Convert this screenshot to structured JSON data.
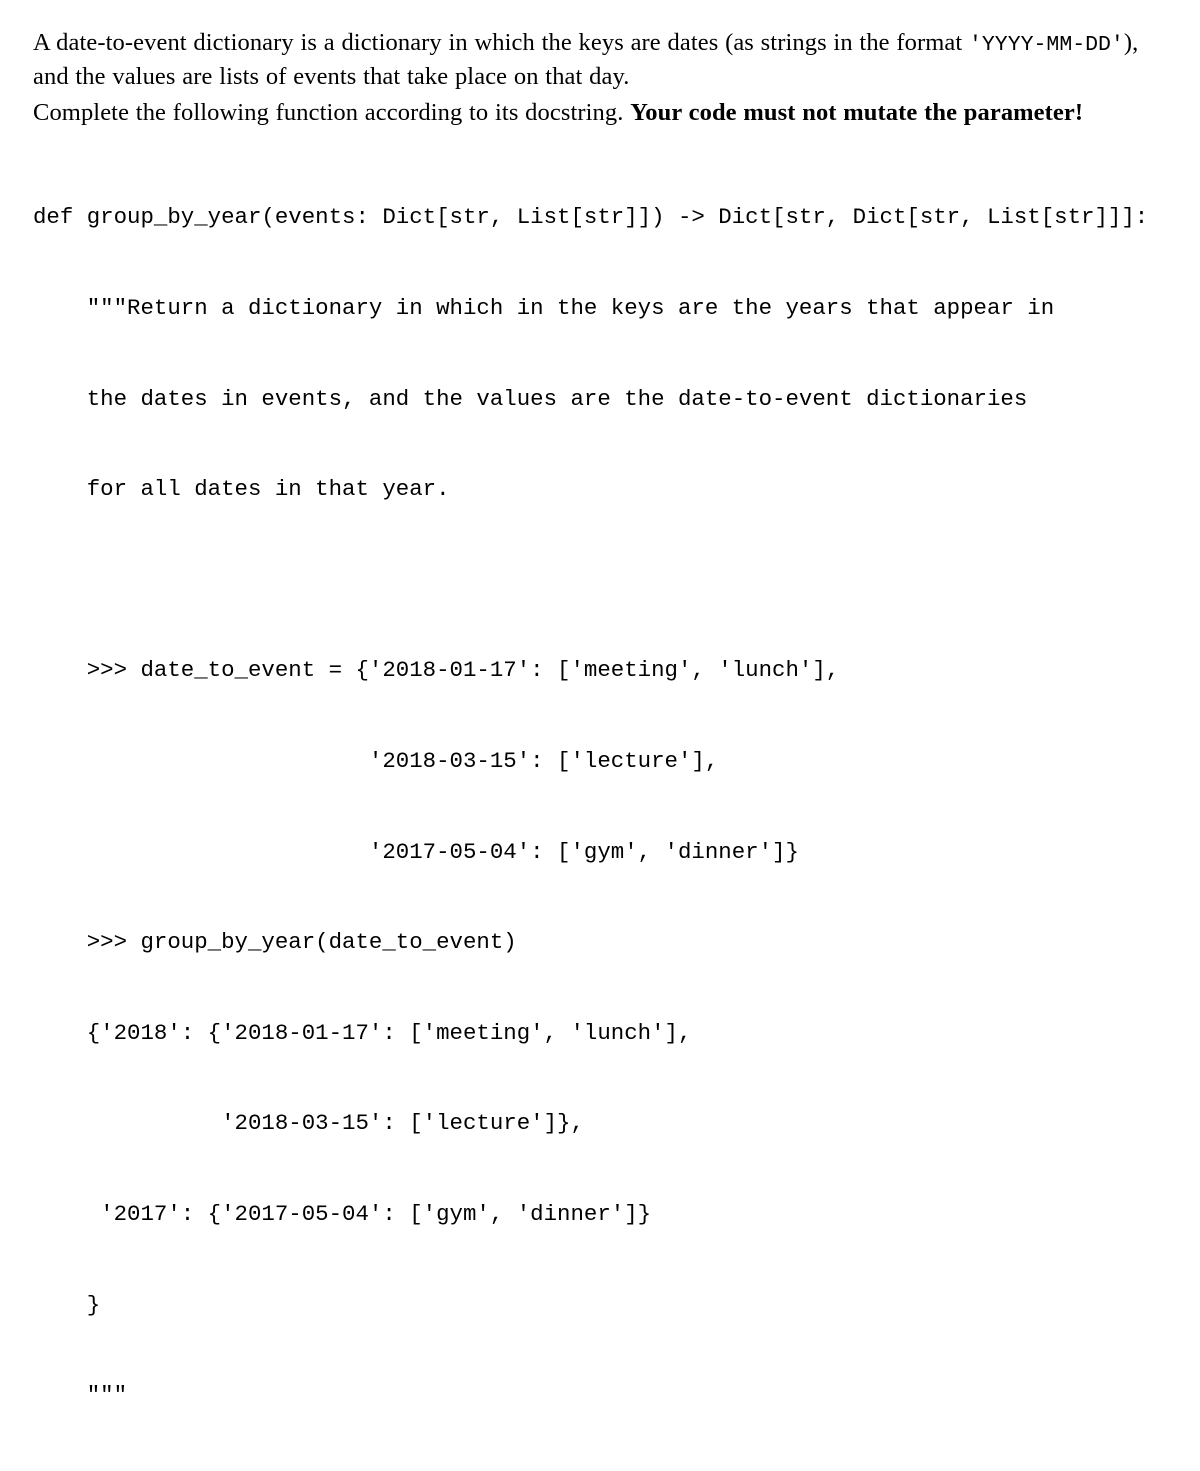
{
  "document": {
    "background_color": "#ffffff",
    "text_color": "#000000"
  },
  "paragraphs": {
    "intro": {
      "part1": "A date-to-event dictionary is a dictionary in which the keys are dates (as strings in the format ",
      "code_format": "'YYYY-MM-DD'",
      "part2": "), and the values are lists of events that take place on that day."
    },
    "instruction": {
      "normal": "Complete the following function according to its docstring. ",
      "emphasis": "Your code must not mutate the parameter!"
    }
  },
  "code": {
    "language": "python",
    "function_name": "group_by_year",
    "signature": "def group_by_year(events: Dict[str, List[str]]) -> Dict[str, Dict[str, List[str]]]:",
    "lines": [
      "def group_by_year(events: Dict[str, List[str]]) -> Dict[str, Dict[str, List[str]]]:",
      "    \"\"\"Return a dictionary in which in the keys are the years that appear in",
      "    the dates in events, and the values are the date-to-event dictionaries",
      "    for all dates in that year.",
      "",
      "    >>> date_to_event = {'2018-01-17': ['meeting', 'lunch'],",
      "                         '2018-03-15': ['lecture'],",
      "                         '2017-05-04': ['gym', 'dinner']}",
      "    >>> group_by_year(date_to_event)",
      "    {'2018': {'2018-01-17': ['meeting', 'lunch'],",
      "              '2018-03-15': ['lecture']},",
      "     '2017': {'2017-05-04': ['gym', 'dinner']}",
      "    }",
      "    \"\"\""
    ],
    "docstring_summary": "Return a dictionary in which in the keys are the years that appear in the dates in events, and the values are the date-to-event dictionaries for all dates in that year.",
    "doctest": {
      "input_variable": "date_to_event",
      "input_value": {
        "2018-01-17": [
          "meeting",
          "lunch"
        ],
        "2018-03-15": [
          "lecture"
        ],
        "2017-05-04": [
          "gym",
          "dinner"
        ]
      },
      "call": "group_by_year(date_to_event)",
      "expected_output": {
        "2018": {
          "2018-01-17": [
            "meeting",
            "lunch"
          ],
          "2018-03-15": [
            "lecture"
          ]
        },
        "2017": {
          "2017-05-04": [
            "gym",
            "dinner"
          ]
        }
      }
    }
  }
}
